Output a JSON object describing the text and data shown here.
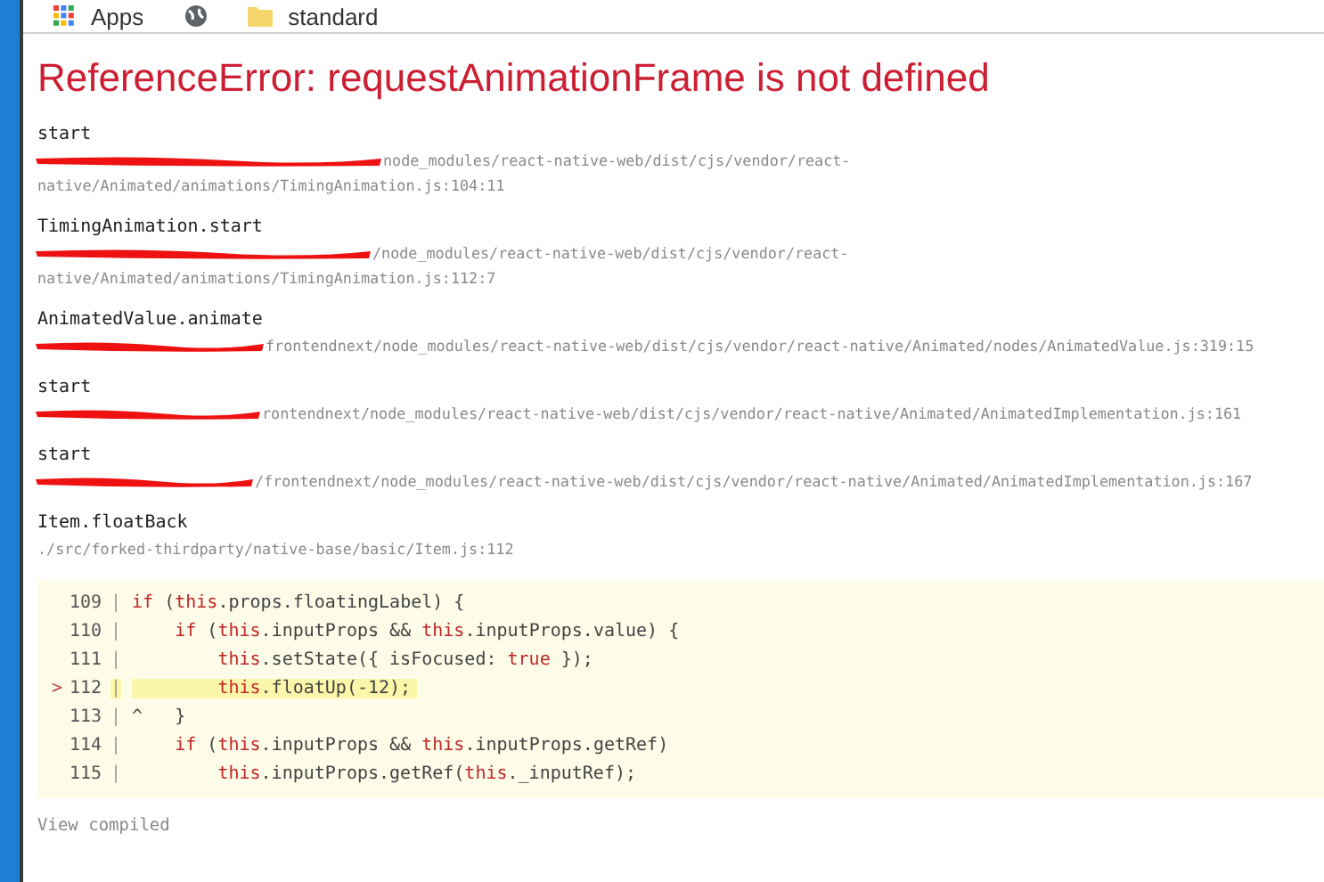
{
  "bookmarks": [
    {
      "kind": "apps",
      "label": "Apps"
    },
    {
      "kind": "globe"
    },
    {
      "kind": "folder",
      "label": "standard"
    }
  ],
  "error": {
    "title": "ReferenceError: requestAnimationFrame is not defined"
  },
  "frames": [
    {
      "name": "start",
      "redacted": true,
      "path": [
        "node_modules/react-native-web/dist/cjs/vendor/react-",
        "native/Animated/animations/TimingAnimation.js:104:11"
      ]
    },
    {
      "name": "TimingAnimation.start",
      "redacted": true,
      "path": [
        "/node_modules/react-native-web/dist/cjs/vendor/react-",
        "native/Animated/animations/TimingAnimation.js:112:7"
      ]
    },
    {
      "name": "AnimatedValue.animate",
      "redacted": true,
      "path": [
        "frontendnext/node_modules/react-native-web/dist/cjs/vendor/react-native/Animated/nodes/AnimatedValue.js:319:15"
      ]
    },
    {
      "name": "start",
      "redacted": true,
      "path": [
        "rontendnext/node_modules/react-native-web/dist/cjs/vendor/react-native/Animated/AnimatedImplementation.js:161"
      ]
    },
    {
      "name": "start",
      "redacted": true,
      "path": [
        "/frontendnext/node_modules/react-native-web/dist/cjs/vendor/react-native/Animated/AnimatedImplementation.js:167"
      ]
    },
    {
      "name": "Item.floatBack",
      "redacted": false,
      "path": [
        "./src/forked-thirdparty/native-base/basic/Item.js:112"
      ]
    }
  ],
  "code": {
    "lines": [
      {
        "number": "109",
        "separator": "|",
        "current": false,
        "tokens": [
          {
            "kind": "keyword",
            "text": "if"
          },
          {
            "kind": "plain",
            "text": " ("
          },
          {
            "kind": "keyword",
            "text": "this"
          },
          {
            "kind": "plain",
            "text": ".props.floatingLabel) {"
          }
        ]
      },
      {
        "number": "110",
        "separator": "|",
        "current": false,
        "tokens": [
          {
            "kind": "keyword",
            "text": "    if"
          },
          {
            "kind": "plain",
            "text": " ("
          },
          {
            "kind": "keyword",
            "text": "this"
          },
          {
            "kind": "plain",
            "text": ".inputProps && "
          },
          {
            "kind": "keyword",
            "text": "this"
          },
          {
            "kind": "plain",
            "text": ".inputProps.value) {"
          }
        ]
      },
      {
        "number": "111",
        "separator": "|",
        "current": false,
        "tokens": [
          {
            "kind": "keyword",
            "text": "        this"
          },
          {
            "kind": "plain",
            "text": ".setState({ isFocused: "
          },
          {
            "kind": "keyword",
            "text": "true"
          },
          {
            "kind": "plain",
            "text": " });"
          }
        ]
      },
      {
        "number": "112",
        "separator": "|",
        "current": true,
        "marker": ">",
        "tokens": [
          {
            "kind": "keyword",
            "text": "        this"
          },
          {
            "kind": "plain",
            "text": ".floatUp(-12);"
          }
        ]
      },
      {
        "number": "113",
        "separator": "|",
        "current": false,
        "tokens": [
          {
            "kind": "plain",
            "text": "^   }"
          }
        ]
      },
      {
        "number": "114",
        "separator": "|",
        "current": false,
        "tokens": [
          {
            "kind": "keyword",
            "text": "    if"
          },
          {
            "kind": "plain",
            "text": " ("
          },
          {
            "kind": "keyword",
            "text": "this"
          },
          {
            "kind": "plain",
            "text": ".inputProps && "
          },
          {
            "kind": "keyword",
            "text": "this"
          },
          {
            "kind": "plain",
            "text": ".inputProps.getRef)"
          }
        ]
      },
      {
        "number": "115",
        "separator": "|",
        "current": false,
        "tokens": [
          {
            "kind": "keyword",
            "text": "        this"
          },
          {
            "kind": "plain",
            "text": ".inputProps.getRef("
          },
          {
            "kind": "keyword",
            "text": "this"
          },
          {
            "kind": "plain",
            "text": "._inputRef);"
          }
        ]
      }
    ]
  },
  "view_compiled": "View compiled"
}
